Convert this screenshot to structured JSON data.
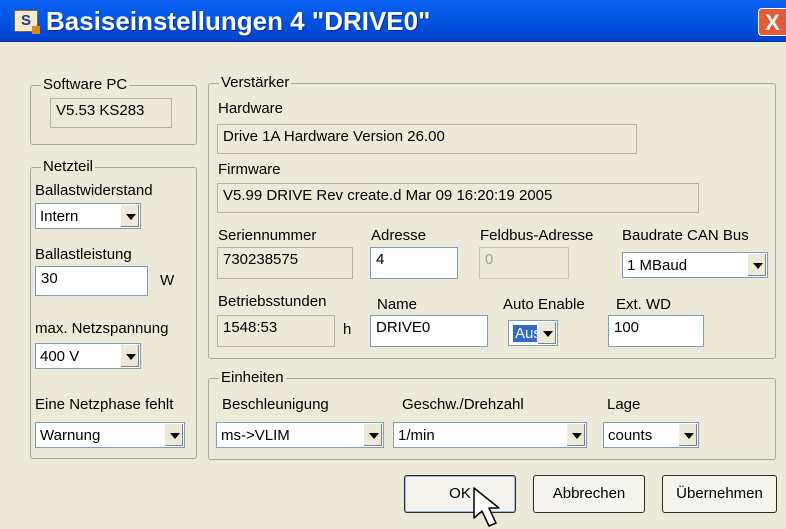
{
  "window": {
    "title": "Basiseinstellungen 4 \"DRIVE0\"",
    "app_icon": "S",
    "close_label": "X"
  },
  "software_pc": {
    "legend": "Software PC",
    "value": "V5.53 KS283"
  },
  "netzteil": {
    "legend": "Netzteil",
    "ballastwiderstand_label": "Ballastwiderstand",
    "ballastwiderstand_value": "Intern",
    "ballastleistung_label": "Ballastleistung",
    "ballastleistung_value": "30",
    "ballastleistung_unit": "W",
    "netzspannung_label": "max. Netzspannung",
    "netzspannung_value": "400 V",
    "netzphase_label": "Eine Netzphase fehlt",
    "netzphase_value": "Warnung"
  },
  "verstaerker": {
    "legend": "Verstärker",
    "hardware_label": "Hardware",
    "hardware_value": "Drive 1A Hardware Version 26.00",
    "firmware_label": "Firmware",
    "firmware_value": "V5.99 DRIVE Rev create.d Mar 09 16:20:19 2005",
    "seriennummer_label": "Seriennummer",
    "seriennummer_value": "730238575",
    "adresse_label": "Adresse",
    "adresse_value": "4",
    "feldbus_label": "Feldbus-Adresse",
    "feldbus_value": "0",
    "baudrate_label": "Baudrate CAN Bus",
    "baudrate_value": "1 MBaud",
    "betriebsstunden_label": "Betriebsstunden",
    "betriebsstunden_value": "1548:53",
    "betriebsstunden_unit": "h",
    "name_label": "Name",
    "name_value": "DRIVE0",
    "auto_enable_label": "Auto Enable",
    "auto_enable_value": "Aus",
    "ext_wd_label": "Ext. WD",
    "ext_wd_value": "100"
  },
  "einheiten": {
    "legend": "Einheiten",
    "beschleunigung_label": "Beschleunigung",
    "beschleunigung_value": "ms->VLIM",
    "geschw_label": "Geschw./Drehzahl",
    "geschw_value": "1/min",
    "lage_label": "Lage",
    "lage_value": "counts"
  },
  "buttons": {
    "ok": "OK",
    "abbrechen": "Abbrechen",
    "uebernehmen": "Übernehmen"
  },
  "colors": {
    "titlebar": "#0054e3",
    "close": "#e35a35",
    "dialog_bg": "#ece9d8",
    "selection": "#316ac5"
  },
  "icons": {
    "cursor": "arrow-cursor-icon"
  }
}
